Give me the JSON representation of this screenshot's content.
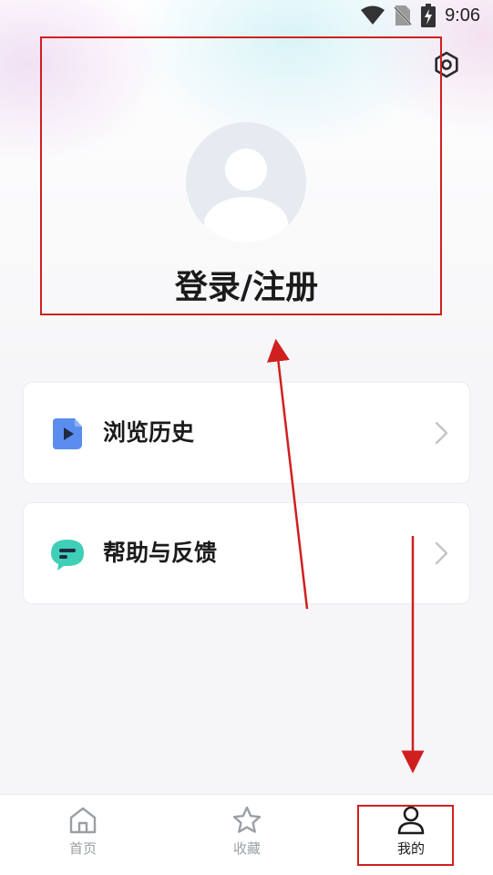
{
  "status_bar": {
    "time": "9:06",
    "icons": [
      "wifi-icon",
      "no-sim-icon",
      "battery-charging-icon"
    ]
  },
  "header": {
    "settings_icon": "gear-icon"
  },
  "profile": {
    "login_label": "登录/注册",
    "avatar_icon": "default-avatar-icon"
  },
  "menu": {
    "items": [
      {
        "label": "浏览历史",
        "icon": "browse-history-icon",
        "icon_color": "#5b8def"
      },
      {
        "label": "帮助与反馈",
        "icon": "help-feedback-icon",
        "icon_color": "#3fcfb6"
      }
    ]
  },
  "tab_bar": {
    "tabs": [
      {
        "label": "首页",
        "icon": "home-icon",
        "active": false
      },
      {
        "label": "收藏",
        "icon": "star-icon",
        "active": false
      },
      {
        "label": "我的",
        "icon": "user-icon",
        "active": true
      }
    ]
  },
  "colors": {
    "annotation": "#d01f1f",
    "active_tab": "#1b1b1b",
    "inactive_tab": "#9aa0a6"
  }
}
